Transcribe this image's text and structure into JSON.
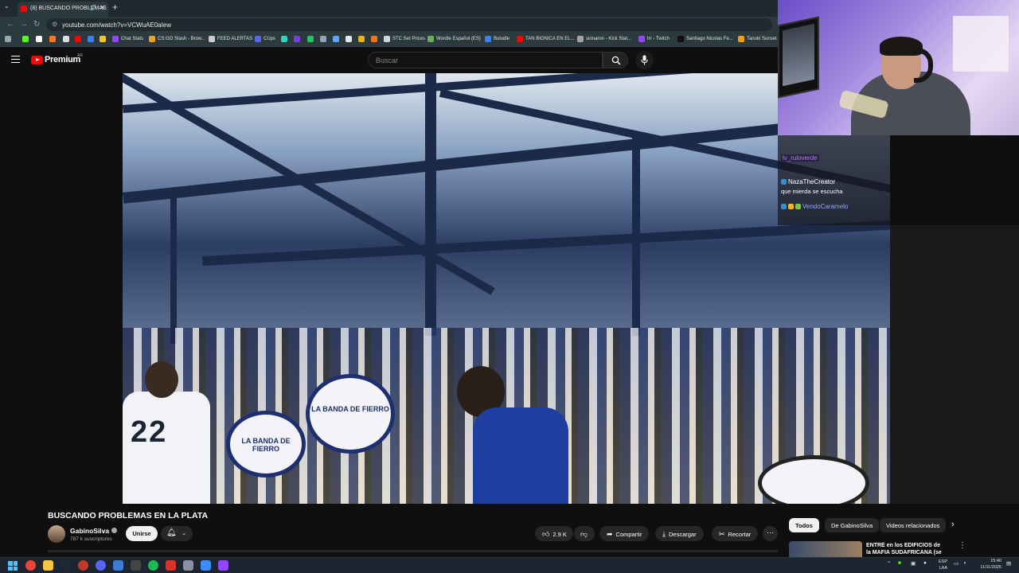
{
  "browser": {
    "tab_title": "(8) BUSCANDO PROBLEMAS",
    "url": "youtube.com/watch?v=VCWuAE0aIew",
    "bookmarks": [
      "Chat Stats",
      "CS:GO Stash - Brow...",
      "FEED ALERTAS",
      "CUps",
      "STC Set Prices",
      "Wordle Español (ES)",
      "Boludle",
      "TAN BIONICA EN EL...",
      "sionaron - Kick Stat...",
      "trr - Twitch",
      "Santiago Nicolas Fe...",
      "Tanuki Sunset"
    ]
  },
  "youtube": {
    "logo_text": "Premium",
    "region": "AR",
    "search_placeholder": "Buscar"
  },
  "chat": {
    "messages": [
      {
        "user": "lv_ruloverde",
        "text": "",
        "color": "#b57bff"
      },
      {
        "user": "NazaTheCreator",
        "text": "que mierda se escucha",
        "color": "#ffffff"
      },
      {
        "user": "VendoCaramelo",
        "text": "",
        "color": "#8fa8ff"
      }
    ]
  },
  "video": {
    "drum_text_1": "LA BANDA DE FIERRO",
    "drum_text_2": "LA BANDA DE FIERRO",
    "jersey_number": "22"
  },
  "video_info": {
    "title": "BUSCANDO PROBLEMAS EN LA PLATA",
    "channel": "GabinoSilva",
    "subscribers": "787 k suscriptores",
    "join_label": "Unirse",
    "likes": "2.9 K",
    "share_label": "Compartir",
    "download_label": "Descargar",
    "clip_label": "Recortar"
  },
  "related": {
    "chips": [
      "Todos",
      "De GabinoSilva",
      "Videos relacionados"
    ],
    "first_title": "ENTRÉ en los EDIFICIOS de la MAFIA SUDAFRICANA (se me"
  },
  "taskbar": {
    "lang": "ESP",
    "lang2": "LAA",
    "time": "15:40",
    "date": "11/11/2025"
  }
}
